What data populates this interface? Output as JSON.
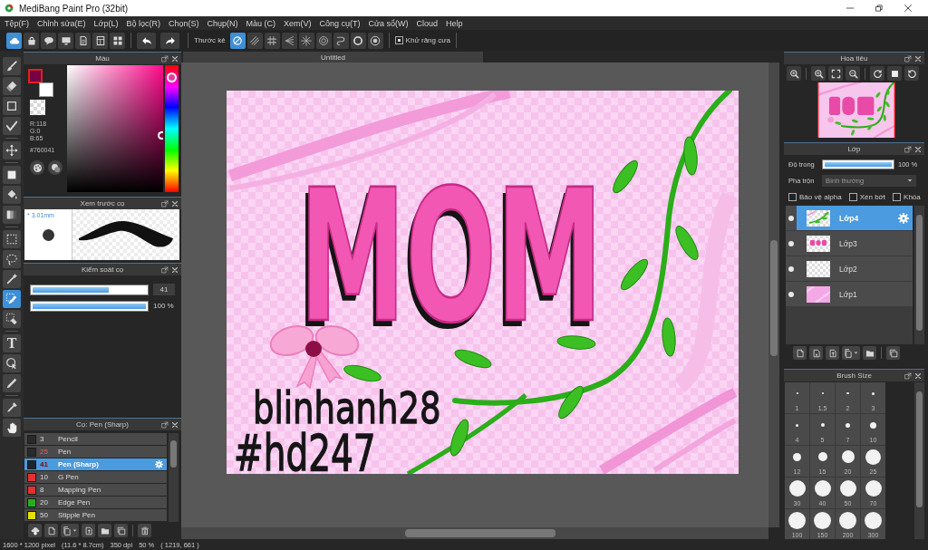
{
  "window": {
    "title": "MediBang Paint Pro (32bit)"
  },
  "menu": [
    "Tệp(F)",
    "Chỉnh sửa(E)",
    "Lớp(L)",
    "Bộ lọc(R)",
    "Chọn(S)",
    "Chụp(N)",
    "Màu (C)",
    "Xem(V)",
    "Công cụ(T)",
    "Cửa sổ(W)",
    "Cloud",
    "Help"
  ],
  "toolbar": {
    "file_buttons": [
      {
        "selected": true
      },
      {
        "selected": false
      },
      {
        "selected": false
      },
      {
        "selected": false
      },
      {
        "selected": false
      },
      {
        "selected": false
      },
      {
        "selected": false
      }
    ],
    "ruler_label": "Thước kẻ",
    "ruler_buttons": [
      {
        "selected": true
      },
      {
        "selected": false
      },
      {
        "selected": false
      },
      {
        "selected": false
      },
      {
        "selected": false
      },
      {
        "selected": false
      },
      {
        "selected": false
      },
      {
        "selected": false
      },
      {
        "selected": false
      }
    ],
    "antialias": {
      "label": "Khử răng cưa",
      "checked": true
    }
  },
  "tools": [
    {
      "selected": false
    },
    {
      "selected": false
    },
    {
      "selected": false
    },
    {
      "selected": false
    },
    {
      "selected": false
    },
    {
      "selected": false
    },
    {
      "selected": false
    },
    {
      "selected": false
    },
    {
      "selected": false
    },
    {
      "selected": false
    },
    {
      "selected": false
    },
    {
      "selected": true
    },
    {
      "selected": false
    },
    {
      "selected": false,
      "glyph": "T"
    },
    {
      "selected": false
    },
    {
      "selected": false
    },
    {
      "selected": false
    },
    {
      "selected": false
    }
  ],
  "color_panel": {
    "title": "Màu",
    "swatches": [
      {
        "color": "#760041",
        "selected": true
      },
      {
        "color": "#ffffff",
        "selected": false
      }
    ],
    "readings": [
      "R:118",
      "G:0",
      "B:65"
    ],
    "hex": "#760041",
    "hue": {
      "level": 0.94
    }
  },
  "brush_preview": {
    "title": "Xem trước cọ",
    "size": "* 3.01mm"
  },
  "brush_control": {
    "title": "Kiểm soát cọ",
    "sliders": [
      {
        "kind": "size",
        "level": 0.67,
        "reading": "41"
      },
      {
        "kind": "opacity",
        "level": 1,
        "reading": "100 %"
      }
    ]
  },
  "brush_list": {
    "title": "Cọ: Pen (Sharp)",
    "items": [
      {
        "color": "#2a2a2a",
        "size": "3",
        "name": "Pencil",
        "size_highlight": false,
        "selected": false
      },
      {
        "color": "#2a2a2a",
        "size": "25",
        "name": "Pen",
        "size_highlight": true,
        "selected": false
      },
      {
        "color": "#1c2633",
        "size": "41",
        "name": "Pen (Sharp)",
        "size_highlight": true,
        "selected": true
      },
      {
        "color": "#e53030",
        "size": "10",
        "name": "G Pen",
        "size_highlight": false,
        "selected": false
      },
      {
        "color": "#e53030",
        "size": "8",
        "name": "Mapping Pen",
        "size_highlight": false,
        "selected": false
      },
      {
        "color": "#22b022",
        "size": "20",
        "name": "Edge Pen",
        "size_highlight": false,
        "selected": false
      },
      {
        "color": "#e6e000",
        "size": "50",
        "name": "Stipple Pen",
        "size_highlight": false,
        "selected": false
      }
    ]
  },
  "canvas": {
    "tab": "Untitled",
    "lettering": "MOM",
    "signature": [
      "blinhanh28",
      "#hd247"
    ]
  },
  "navigator": {
    "title": "Hoa tiêu"
  },
  "layers_panel": {
    "title": "Lớp",
    "opacity": {
      "label": "Độ trong",
      "level": 1,
      "reading": "100 %"
    },
    "blend": {
      "label": "Pha trộn",
      "value": "Bình thường"
    },
    "options": [
      {
        "label": "Bảo vệ alpha",
        "checked": false
      },
      {
        "label": "Xén bớt",
        "checked": false
      },
      {
        "label": "Khóa",
        "checked": false
      }
    ],
    "layers": [
      {
        "name": "Lớp4",
        "kind": "leaves",
        "selected": true,
        "visible": true
      },
      {
        "name": "Lớp3",
        "kind": "lettering",
        "selected": false,
        "visible": true
      },
      {
        "name": "Lớp2",
        "kind": "empty",
        "selected": false,
        "visible": true
      },
      {
        "name": "Lớp1",
        "kind": "fill",
        "selected": false,
        "visible": true
      }
    ]
  },
  "brush_size": {
    "title": "Brush Size",
    "sizes": [
      "1",
      "1.5",
      "2",
      "3",
      "4",
      "5",
      "7",
      "10",
      "12",
      "15",
      "20",
      "25",
      "30",
      "40",
      "50",
      "70",
      "100",
      "150",
      "200",
      "300"
    ]
  },
  "status_bar": [
    "1600 * 1200 pixel",
    "(11.6 * 8.7cm)",
    "350 dpi",
    "50 %",
    "( 1219, 661 )"
  ]
}
